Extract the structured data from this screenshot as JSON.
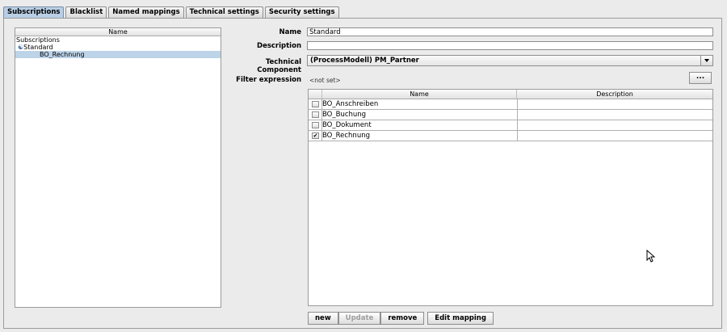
{
  "tabs": [
    "Subscriptions",
    "Blacklist",
    "Named mappings",
    "Technical settings",
    "Security settings"
  ],
  "tree": {
    "header": "Name",
    "rows": [
      "Subscriptions",
      "Standard",
      "BO_Rechnung"
    ]
  },
  "form": {
    "name_label": "Name",
    "name_value": "Standard",
    "description_label": "Description",
    "description_value": "",
    "component_label": "Technical Component",
    "component_value": "(ProcessModell) PM_Partner",
    "filter_label": "Filter expression",
    "filter_value": "<not set>",
    "filter_button": "..."
  },
  "table": {
    "columns": [
      "Name",
      "Description"
    ],
    "rows": [
      {
        "name": "BO_Anschreiben",
        "description": "",
        "checked": false
      },
      {
        "name": "BO_Buchung",
        "description": "",
        "checked": false
      },
      {
        "name": "BO_Dokument",
        "description": "",
        "checked": false
      },
      {
        "name": "BO_Rechnung",
        "description": "",
        "checked": true
      }
    ]
  },
  "buttons": {
    "new": "new",
    "update": "Update",
    "remove": "remove",
    "edit_mapping": "Edit mapping"
  },
  "icons": {
    "tree_toggle": "tree-expand-icon",
    "check": "✔"
  }
}
